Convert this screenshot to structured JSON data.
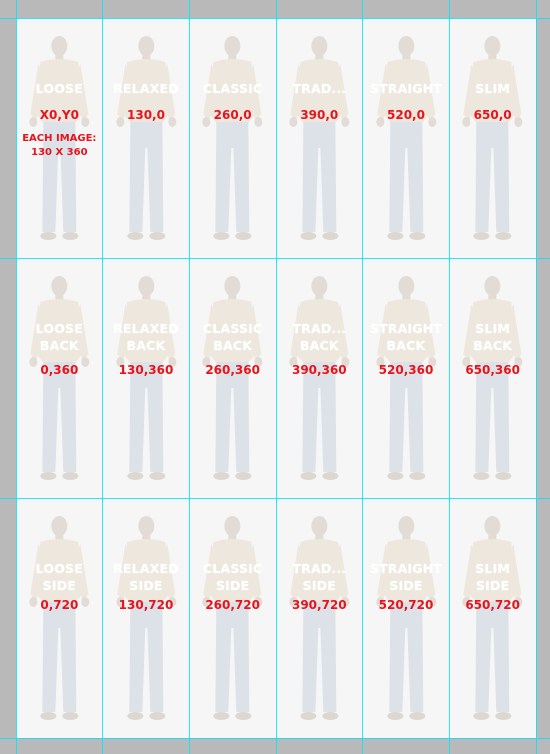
{
  "colors": {
    "workspace": "#b9b9b9",
    "canvas": "#fdfdfd",
    "guide": "#00e5ff",
    "coordinate_text": "#e8141c",
    "label_text": "#ffffff",
    "shirt": "#e9dccb",
    "jeans": "#c9d3de",
    "skin": "#d3c6bd"
  },
  "icons": [
    "person-figure-icon"
  ],
  "note": "EACH IMAGE:\n130 X 360",
  "rows": [
    {
      "cells": [
        {
          "label": "LOOSE",
          "coord": "X0,Y0"
        },
        {
          "label": "RELAXED",
          "coord": "130,0"
        },
        {
          "label": "CLASSIC",
          "coord": "260,0"
        },
        {
          "label": "TRAD...",
          "coord": "390,0"
        },
        {
          "label": "STRAIGHT",
          "coord": "520,0"
        },
        {
          "label": "SLIM",
          "coord": "650,0"
        }
      ]
    },
    {
      "cells": [
        {
          "label": "LOOSE\nBACK",
          "coord": "0,360"
        },
        {
          "label": "RELAXED\nBACK",
          "coord": "130,360"
        },
        {
          "label": "CLASSIC\nBACK",
          "coord": "260,360"
        },
        {
          "label": "TRAD...\nBACK",
          "coord": "390,360"
        },
        {
          "label": "STRAIGHT\nBACK",
          "coord": "520,360"
        },
        {
          "label": "SLIM\nBACK",
          "coord": "650,360"
        }
      ]
    },
    {
      "cells": [
        {
          "label": "LOOSE\nSIDE",
          "coord": "0,720"
        },
        {
          "label": "RELAXED\nSIDE",
          "coord": "130,720"
        },
        {
          "label": "CLASSIC\nSIDE",
          "coord": "260,720"
        },
        {
          "label": "TRAD...\nSIDE",
          "coord": "390,720"
        },
        {
          "label": "STRAIGHT\nSIDE",
          "coord": "520,720"
        },
        {
          "label": "SLIM\nSIDE",
          "coord": "650,720"
        }
      ]
    }
  ]
}
